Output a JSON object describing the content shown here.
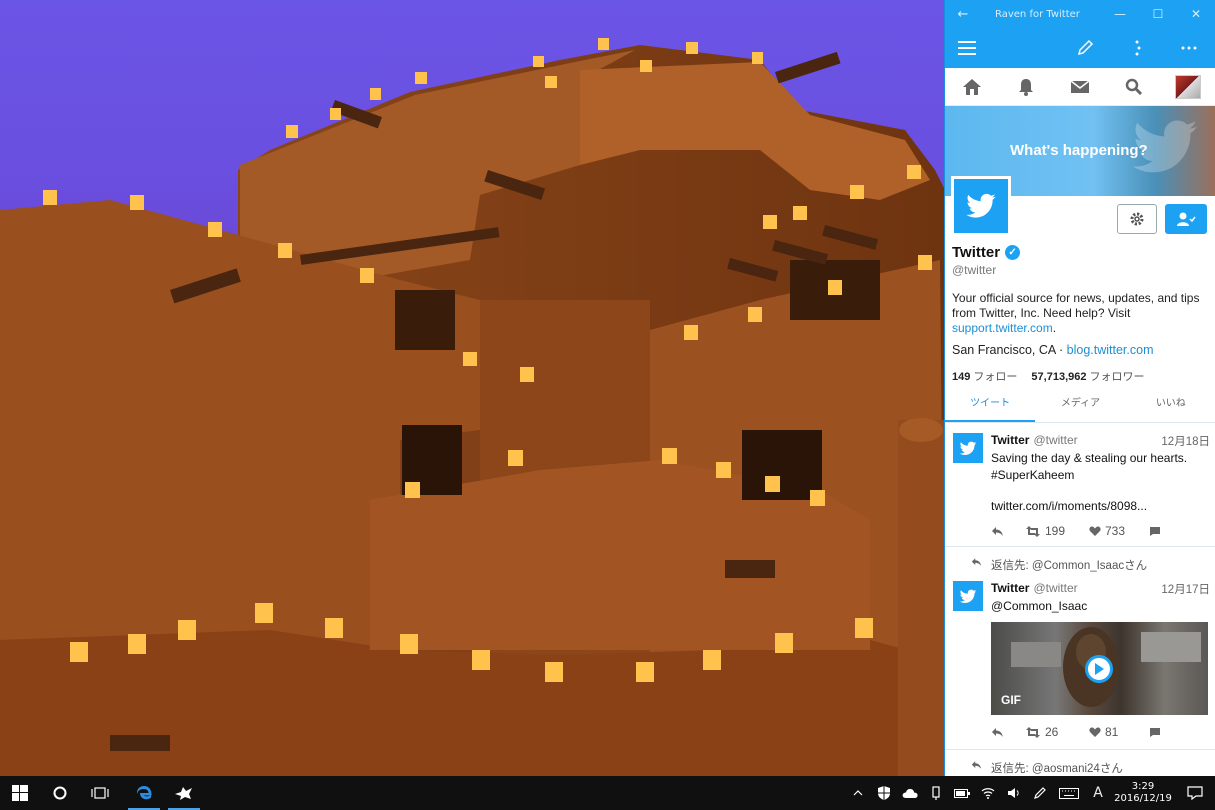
{
  "window": {
    "title": "Raven for Twitter",
    "back_glyph": "←",
    "minimize_glyph": "—",
    "maximize_glyph": "☐",
    "close_glyph": "✕"
  },
  "banner": {
    "headline": "What's happening?"
  },
  "profile": {
    "name": "Twitter",
    "handle": "@twitter",
    "bio": "Your official source for news, updates, and tips from Twitter, Inc. Need help? Visit",
    "bio_link": "support.twitter.com",
    "bio_end": ".",
    "location": "San Francisco, CA",
    "separator": "·",
    "website": "blog.twitter.com",
    "following_count": "149",
    "following_label": "フォロー",
    "followers_count": "57,713,962",
    "followers_label": "フォロワー"
  },
  "tabs": [
    "ツイート",
    "メディア",
    "いいね"
  ],
  "tweets": [
    {
      "name": "Twitter",
      "handle": "@twitter",
      "date": "12月18日",
      "text": "Saving the day & stealing our hearts.",
      "hashtag": "#SuperKaheem",
      "link": "twitter.com/i/moments/8098...",
      "retweets": "199",
      "likes": "733"
    },
    {
      "reply_context": "返信先: @Common_Isaacさん",
      "name": "Twitter",
      "handle": "@twitter",
      "date": "12月17日",
      "mention": "@Common_Isaac",
      "media_tag": "GIF",
      "retweets": "26",
      "likes": "81"
    },
    {
      "reply_context": "返信先: @aosmani24さん"
    }
  ],
  "taskbar": {
    "time": "3:29",
    "date": "2016/12/19",
    "ime_indicator": "A"
  },
  "colors": {
    "accent": "#1da1f2",
    "link": "#1b8fd6",
    "taskbar": "#101010"
  }
}
